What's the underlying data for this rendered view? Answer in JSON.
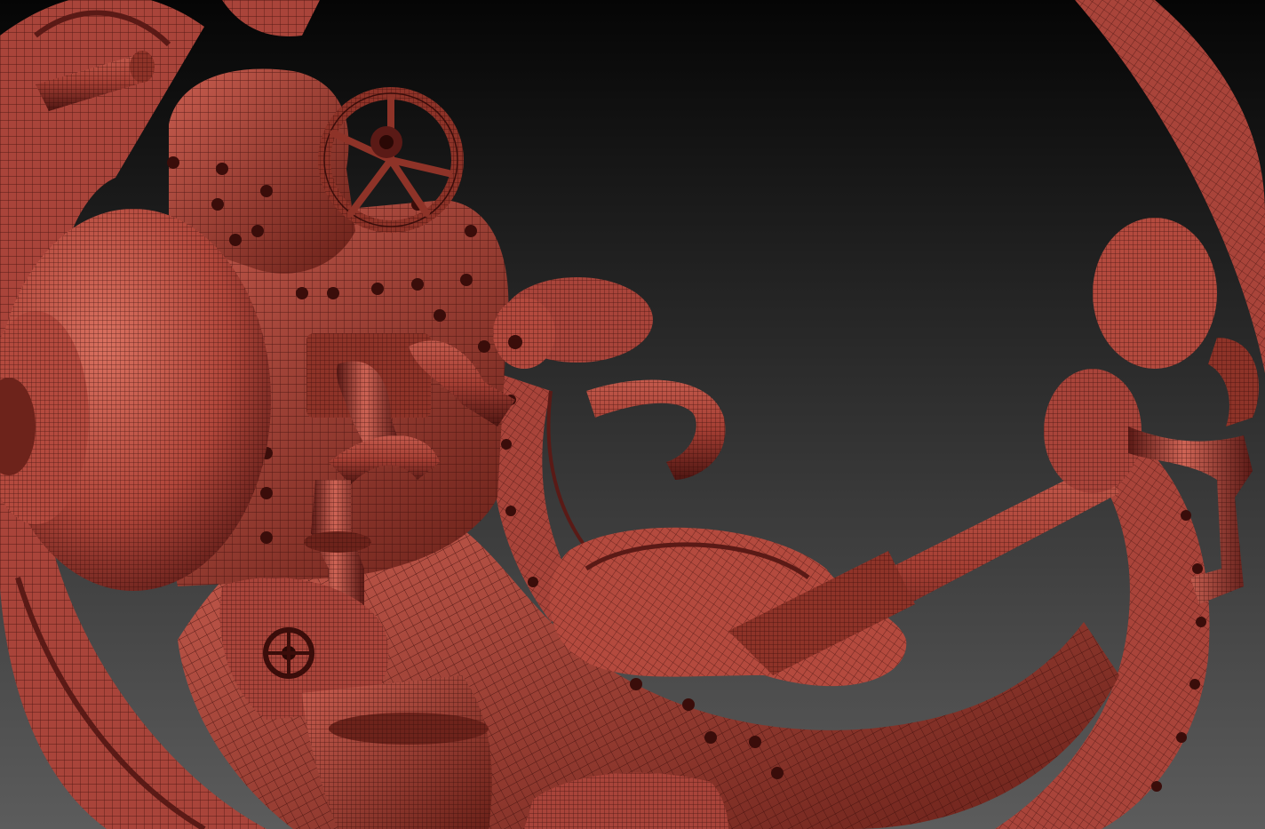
{
  "scene": {
    "description_free": true,
    "colors": {
      "background_top": "#050505",
      "background_bottom": "#5a5a5a",
      "mesh_base": "#b2483e",
      "mesh_light": "#d46a5c",
      "mesh_dark": "#5a1a16",
      "wire": "#3a0d0a"
    },
    "icons": [
      "valve-wheel-icon",
      "small-valve-icon"
    ]
  }
}
